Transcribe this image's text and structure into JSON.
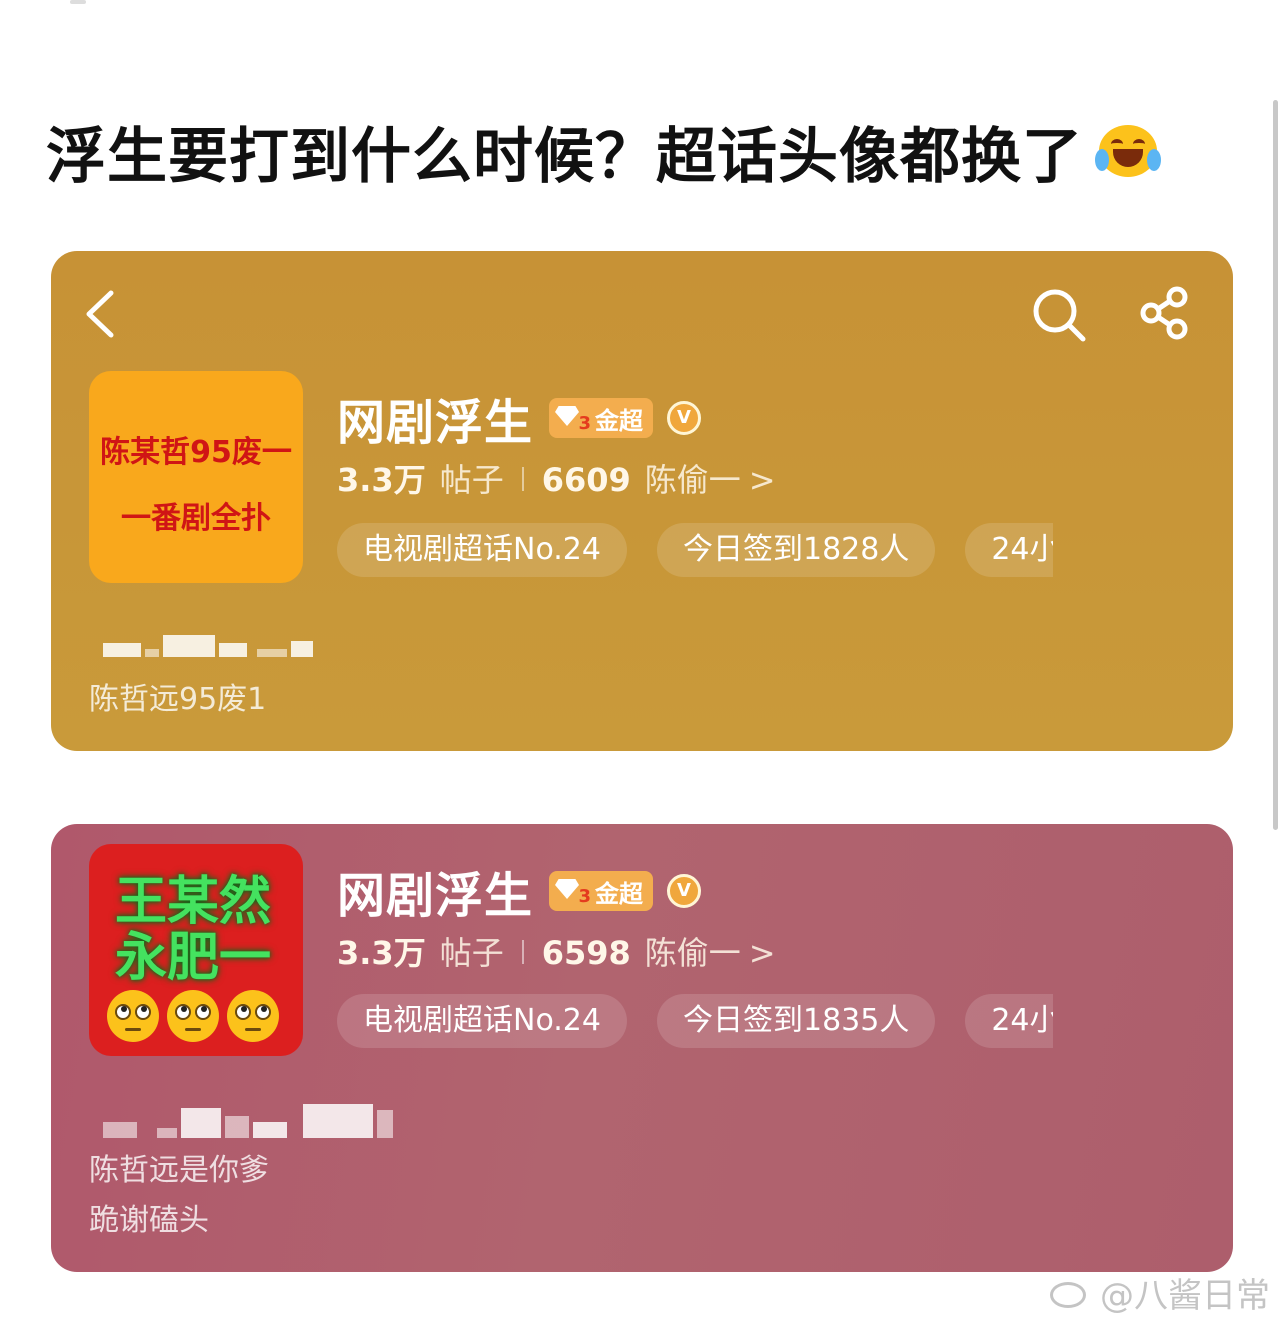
{
  "post": {
    "title": "浮生要打到什么时候？超话头像都换了",
    "title_emoji": "laughing-with-tears-icon"
  },
  "cards": [
    {
      "theme": "gold",
      "background": "#c8963a",
      "nav": {
        "back": "chevron-left-icon",
        "search": "search-icon",
        "share": "share-icon"
      },
      "avatar": {
        "lines": [
          "陈某哲95废一",
          "一番剧全扑"
        ],
        "bg": "#f9a81c",
        "text_color": "#d01515"
      },
      "name": "网剧浮生",
      "badge": {
        "level": "3",
        "label": "金超"
      },
      "verified": "V",
      "stats": {
        "posts_num": "3.3万",
        "posts_label": "帖子",
        "fans_num": "6609",
        "fans_label": "陈偷一",
        "arrow": ">"
      },
      "chips": [
        "电视剧超话No.24",
        "今日签到1828人",
        "24小"
      ],
      "bio": [
        "陈哲远95废1"
      ]
    },
    {
      "theme": "rose",
      "background": "#b05c6d",
      "avatar": {
        "lines": [
          "王某然",
          "永肥一"
        ],
        "bg": "#dc1f1f",
        "text_color": "#44e25f",
        "emoji": "face-with-rolling-eyes-icon"
      },
      "name": "网剧浮生",
      "badge": {
        "level": "3",
        "label": "金超"
      },
      "verified": "V",
      "stats": {
        "posts_num": "3.3万",
        "posts_label": "帖子",
        "fans_num": "6598",
        "fans_label": "陈偷一",
        "arrow": ">"
      },
      "chips": [
        "电视剧超话No.24",
        "今日签到1835人",
        "24小"
      ],
      "bio": [
        "陈哲远是你爹",
        "跪谢磕头"
      ]
    }
  ],
  "watermark": {
    "text": "@八酱日常",
    "icon": "weibo-logo-icon"
  }
}
